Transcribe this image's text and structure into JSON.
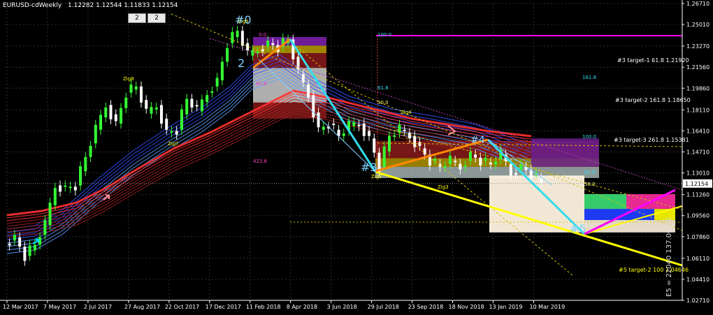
{
  "header": {
    "symbol": "EURUSD-cdWeekly",
    "ohlc": "1.12282 1.12544 1.11833 1.12154",
    "btn1": "2",
    "btn2": "2"
  },
  "price_axis": {
    "ticks": [
      "1.26710",
      "1.25010",
      "1.23270",
      "1.21560",
      "1.19860",
      "1.18110",
      "1.16410",
      "1.14710",
      "1.13010",
      "1.11260",
      "1.09560",
      "1.07860",
      "1.06110",
      "1.04410",
      "1.02710"
    ],
    "current": "1.12154"
  },
  "time_axis": {
    "ticks": [
      "12 Mar 2017",
      "7 May 2017",
      "2 Jul 2017",
      "27 Aug 2017",
      "22 Oct 2017",
      "17 Dec 2017",
      "11 Feb 2018",
      "8 Apr 2018",
      "3 Jun 2018",
      "29 Jul 2018",
      "23 Sep 2018",
      "18 Nov 2018",
      "13 Jan 2019",
      "10 Mar 2019"
    ]
  },
  "annotations": {
    "t1": "#3 target-1 61.8 1.21920",
    "t2": "#3 target-2 161.8 1.18650",
    "t3": "#3 target-3 261.8 1.15381",
    "t5": "#5 target-2 100 1.04646",
    "vertical": "E5 = 22040 137.06.00",
    "fib_100a": "100.0",
    "fib_618a": "61.8",
    "fib_500a": "50.0",
    "fib_1618": "161.8",
    "fib_100b": "100.0",
    "fib_618b": "61.8",
    "fib_500b": "50.0",
    "fib_4236": "423.6",
    "fib_618c": "61.8",
    "fib_00": "0.0",
    "zig8": "Zig8",
    "zig7": "Zig7",
    "zig6": "Zig6",
    "zig4": "Zig4",
    "zig3": "Zig3",
    "zig2": "Zig2",
    "h0": "#0",
    "h3": "#3",
    "h4": "#4",
    "h5": "#5",
    "h2": "2"
  },
  "colors": {
    "bull": "#33ff33",
    "bear": "#ffffff",
    "grid": "#2e2e2e",
    "magenta": "#ff00ff",
    "yellow": "#ffff00",
    "cyan": "#33ddee",
    "orange": "#ff8800"
  },
  "chart_data": {
    "type": "candlestick",
    "title": "EURUSD-cdWeekly",
    "x_range": [
      "12 Mar 2017",
      "31 Mar 2019"
    ],
    "ylim": [
      1.0271,
      1.2671
    ],
    "last_price": 1.12154,
    "series": [
      {
        "name": "close_path",
        "points": [
          [
            "12 Mar 2017",
            1.073
          ],
          [
            "26 Mar 2017",
            1.078
          ],
          [
            "9 Apr 2017",
            1.063
          ],
          [
            "23 Apr 2017",
            1.072
          ],
          [
            "7 May 2017",
            1.088
          ],
          [
            "21 May 2017",
            1.12
          ],
          [
            "4 Jun 2017",
            1.118
          ],
          [
            "18 Jun 2017",
            1.12
          ],
          [
            "2 Jul 2017",
            1.143
          ],
          [
            "16 Jul 2017",
            1.165
          ],
          [
            "30 Jul 2017",
            1.185
          ],
          [
            "13 Aug 2017",
            1.17
          ],
          [
            "27 Aug 2017",
            1.195
          ],
          [
            "10 Sep 2017",
            1.2
          ],
          [
            "24 Sep 2017",
            1.178
          ],
          [
            "8 Oct 2017",
            1.185
          ],
          [
            "22 Oct 2017",
            1.163
          ],
          [
            "5 Nov 2017",
            1.165
          ],
          [
            "19 Nov 2017",
            1.19
          ],
          [
            "3 Dec 2017",
            1.18
          ],
          [
            "17 Dec 2017",
            1.195
          ],
          [
            "31 Dec 2017",
            1.205
          ],
          [
            "14 Jan 2018",
            1.235
          ],
          [
            "28 Jan 2018",
            1.245
          ],
          [
            "11 Feb 2018",
            1.225
          ],
          [
            "25 Feb 2018",
            1.23
          ],
          [
            "11 Mar 2018",
            1.235
          ],
          [
            "25 Mar 2018",
            1.232
          ],
          [
            "8 Apr 2018",
            1.238
          ],
          [
            "22 Apr 2018",
            1.21
          ],
          [
            "6 May 2018",
            1.193
          ],
          [
            "20 May 2018",
            1.165
          ],
          [
            "3 Jun 2018",
            1.17
          ],
          [
            "17 Jun 2018",
            1.16
          ],
          [
            "1 Jul 2018",
            1.168
          ],
          [
            "15 Jul 2018",
            1.17
          ],
          [
            "29 Jul 2018",
            1.158
          ],
          [
            "12 Aug 2018",
            1.135
          ],
          [
            "26 Aug 2018",
            1.16
          ],
          [
            "9 Sep 2018",
            1.165
          ],
          [
            "23 Sep 2018",
            1.16
          ],
          [
            "7 Oct 2018",
            1.15
          ],
          [
            "21 Oct 2018",
            1.14
          ],
          [
            "4 Nov 2018",
            1.135
          ],
          [
            "18 Nov 2018",
            1.14
          ],
          [
            "2 Dec 2018",
            1.135
          ],
          [
            "16 Dec 2018",
            1.145
          ],
          [
            "30 Dec 2018",
            1.14
          ],
          [
            "13 Jan 2019",
            1.137
          ],
          [
            "27 Jan 2019",
            1.145
          ],
          [
            "10 Feb 2019",
            1.13
          ],
          [
            "24 Feb 2019",
            1.135
          ],
          [
            "10 Mar 2019",
            1.13
          ],
          [
            "24 Mar 2019",
            1.122
          ]
        ]
      }
    ]
  }
}
